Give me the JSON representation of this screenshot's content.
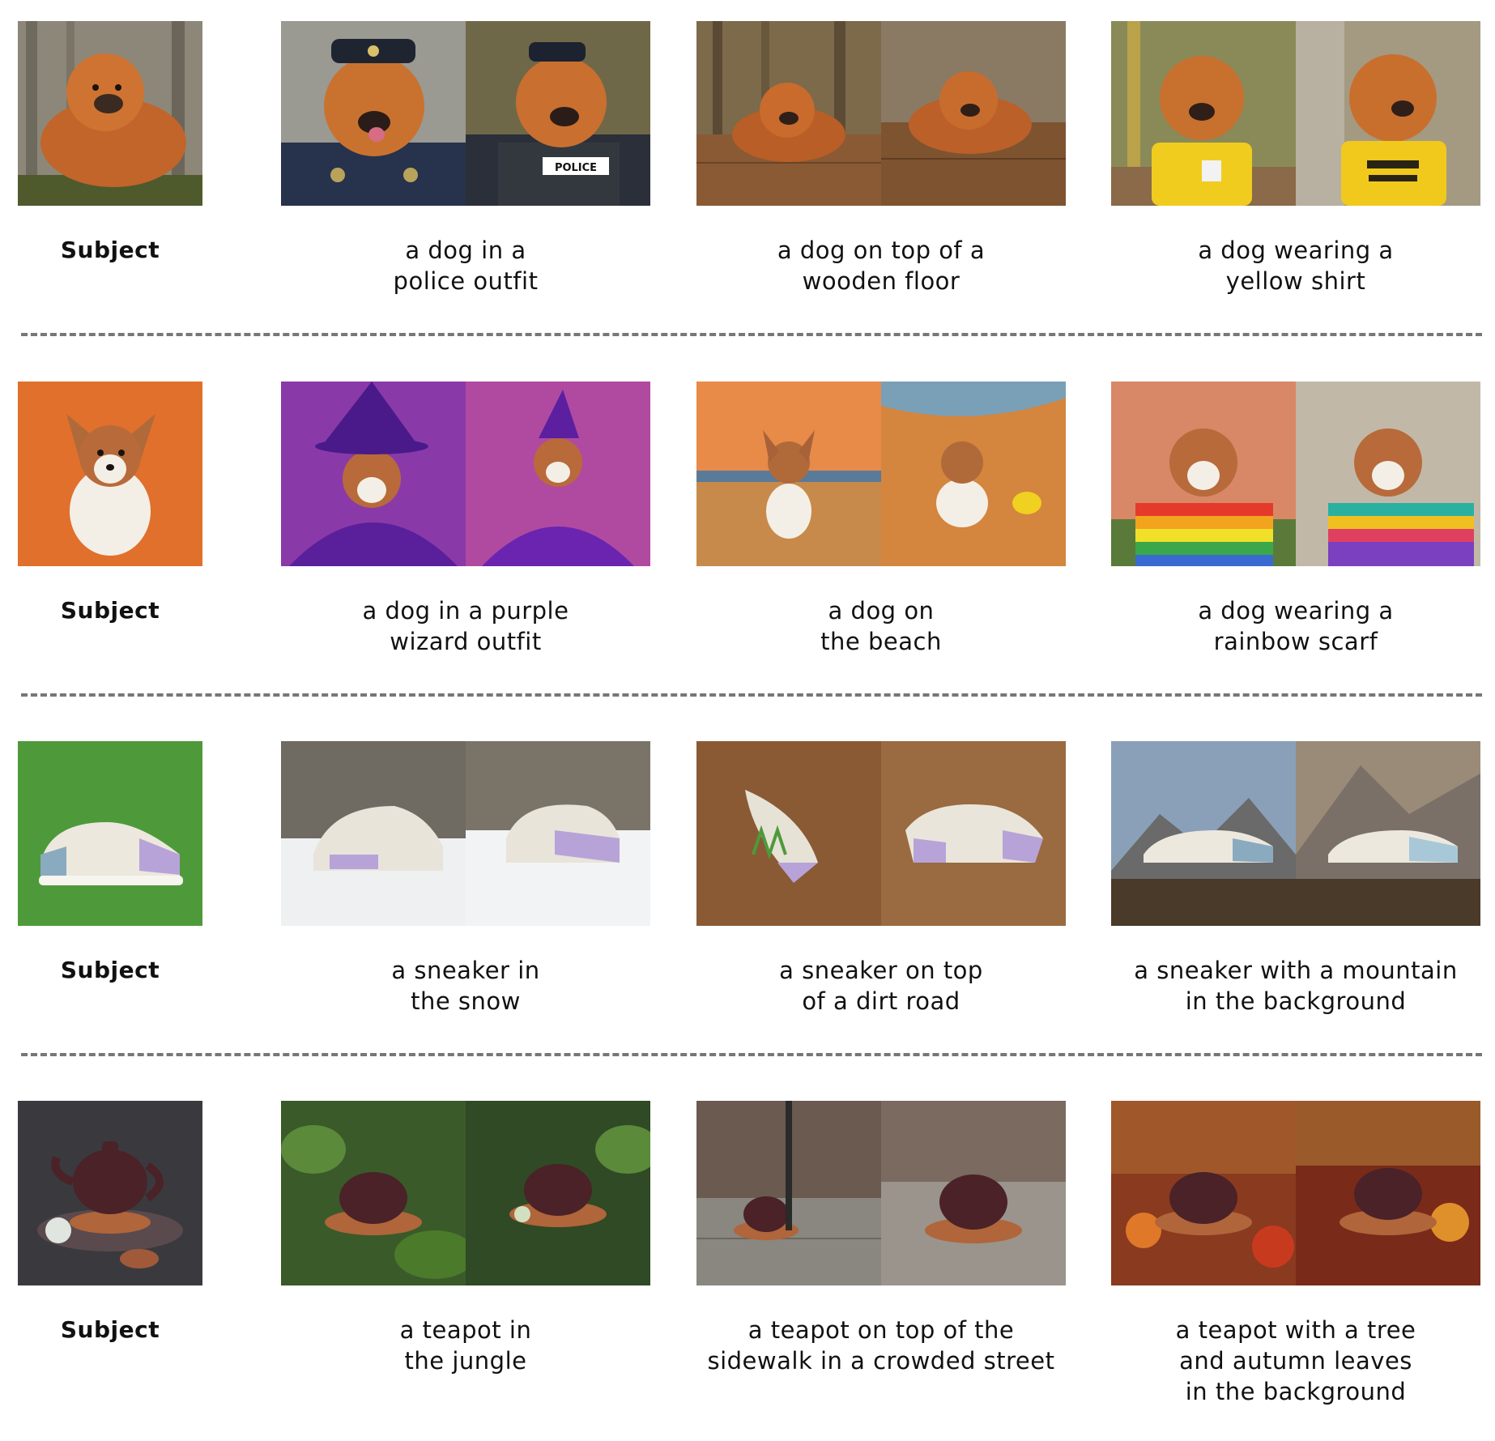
{
  "rows": [
    {
      "subject_label": "Subject",
      "captions": [
        "a dog in a\npolice outfit",
        "a dog on top of a\nwooden floor",
        "a dog wearing a\nyellow shirt"
      ],
      "badge_text": "POLICE",
      "colors": {
        "fur": "#c8682a",
        "bg": "#8a8272"
      }
    },
    {
      "subject_label": "Subject",
      "captions": [
        "a dog in a purple\nwizard outfit",
        "a dog on\nthe beach",
        "a dog wearing a\nrainbow scarf"
      ],
      "colors": {
        "fur": "#b86a3a",
        "bg": "#e0702c"
      }
    },
    {
      "subject_label": "Subject",
      "captions": [
        "a sneaker in\nthe snow",
        "a sneaker on top\nof a dirt road",
        "a sneaker with a mountain\nin the background"
      ],
      "colors": {
        "shoe": "#e9e6dc",
        "accent": "#b7a3d8"
      }
    },
    {
      "subject_label": "Subject",
      "captions": [
        "a teapot in\nthe jungle",
        "a teapot on top of the\nsidewalk in a crowded street",
        "a teapot with a tree\nand autumn leaves\nin the background"
      ],
      "colors": {
        "teapot": "#4a2228",
        "tray": "#b0653a"
      }
    }
  ]
}
